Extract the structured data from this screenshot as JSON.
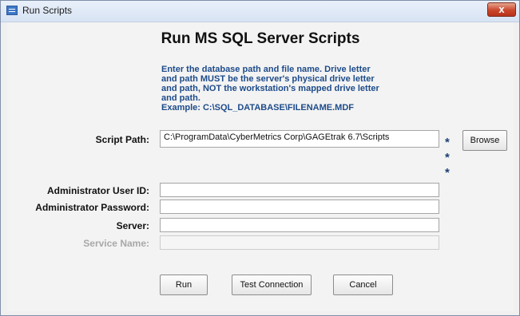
{
  "window": {
    "title": "Run Scripts",
    "close_label": "x"
  },
  "heading": "Run MS SQL Server Scripts",
  "instructions": [
    "Enter the database path and file name.  Drive letter",
    "and path MUST be the server's physical drive letter",
    "and path, NOT the workstation's mapped drive letter",
    "and path.",
    "Example: C:\\SQL_DATABASE\\FILENAME.MDF"
  ],
  "form": {
    "script_path_label": "Script Path:",
    "script_path_value": "C:\\ProgramData\\CyberMetrics Corp\\GAGEtrak 6.7\\Scripts",
    "admin_user_label": "Administrator User ID:",
    "admin_user_value": "",
    "admin_password_label": "Administrator Password:",
    "admin_password_value": "",
    "server_label": "Server:",
    "server_value": "",
    "service_name_label": "Service Name:",
    "service_name_value": "",
    "required_marker": "*"
  },
  "buttons": {
    "browse": "Browse",
    "run": "Run",
    "test_connection": "Test Connection",
    "cancel": "Cancel"
  },
  "colors": {
    "instruction_text": "#1d4b8a",
    "required_marker": "#1d3f74",
    "close_button": "#c9462c"
  }
}
